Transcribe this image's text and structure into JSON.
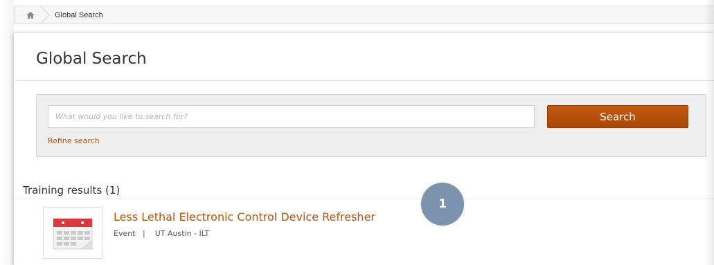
{
  "breadcrumb": {
    "home_icon": "home-icon",
    "current": "Global Search"
  },
  "page": {
    "title": "Global Search"
  },
  "search": {
    "placeholder": "What would you like to search for?",
    "value": "",
    "button_label": "Search",
    "refine_label": "Refine search"
  },
  "results": {
    "heading": "Training results (1)",
    "items": [
      {
        "icon": "calendar-icon",
        "title": "Less Lethal Electronic Control Device Refresher",
        "type": "Event",
        "separator": "|",
        "provider": "UT Austin - ILT"
      }
    ]
  },
  "annotation": {
    "step_number": "1",
    "color": "#7b93ad"
  },
  "colors": {
    "accent": "#b8540c",
    "button": "#b5500a"
  }
}
